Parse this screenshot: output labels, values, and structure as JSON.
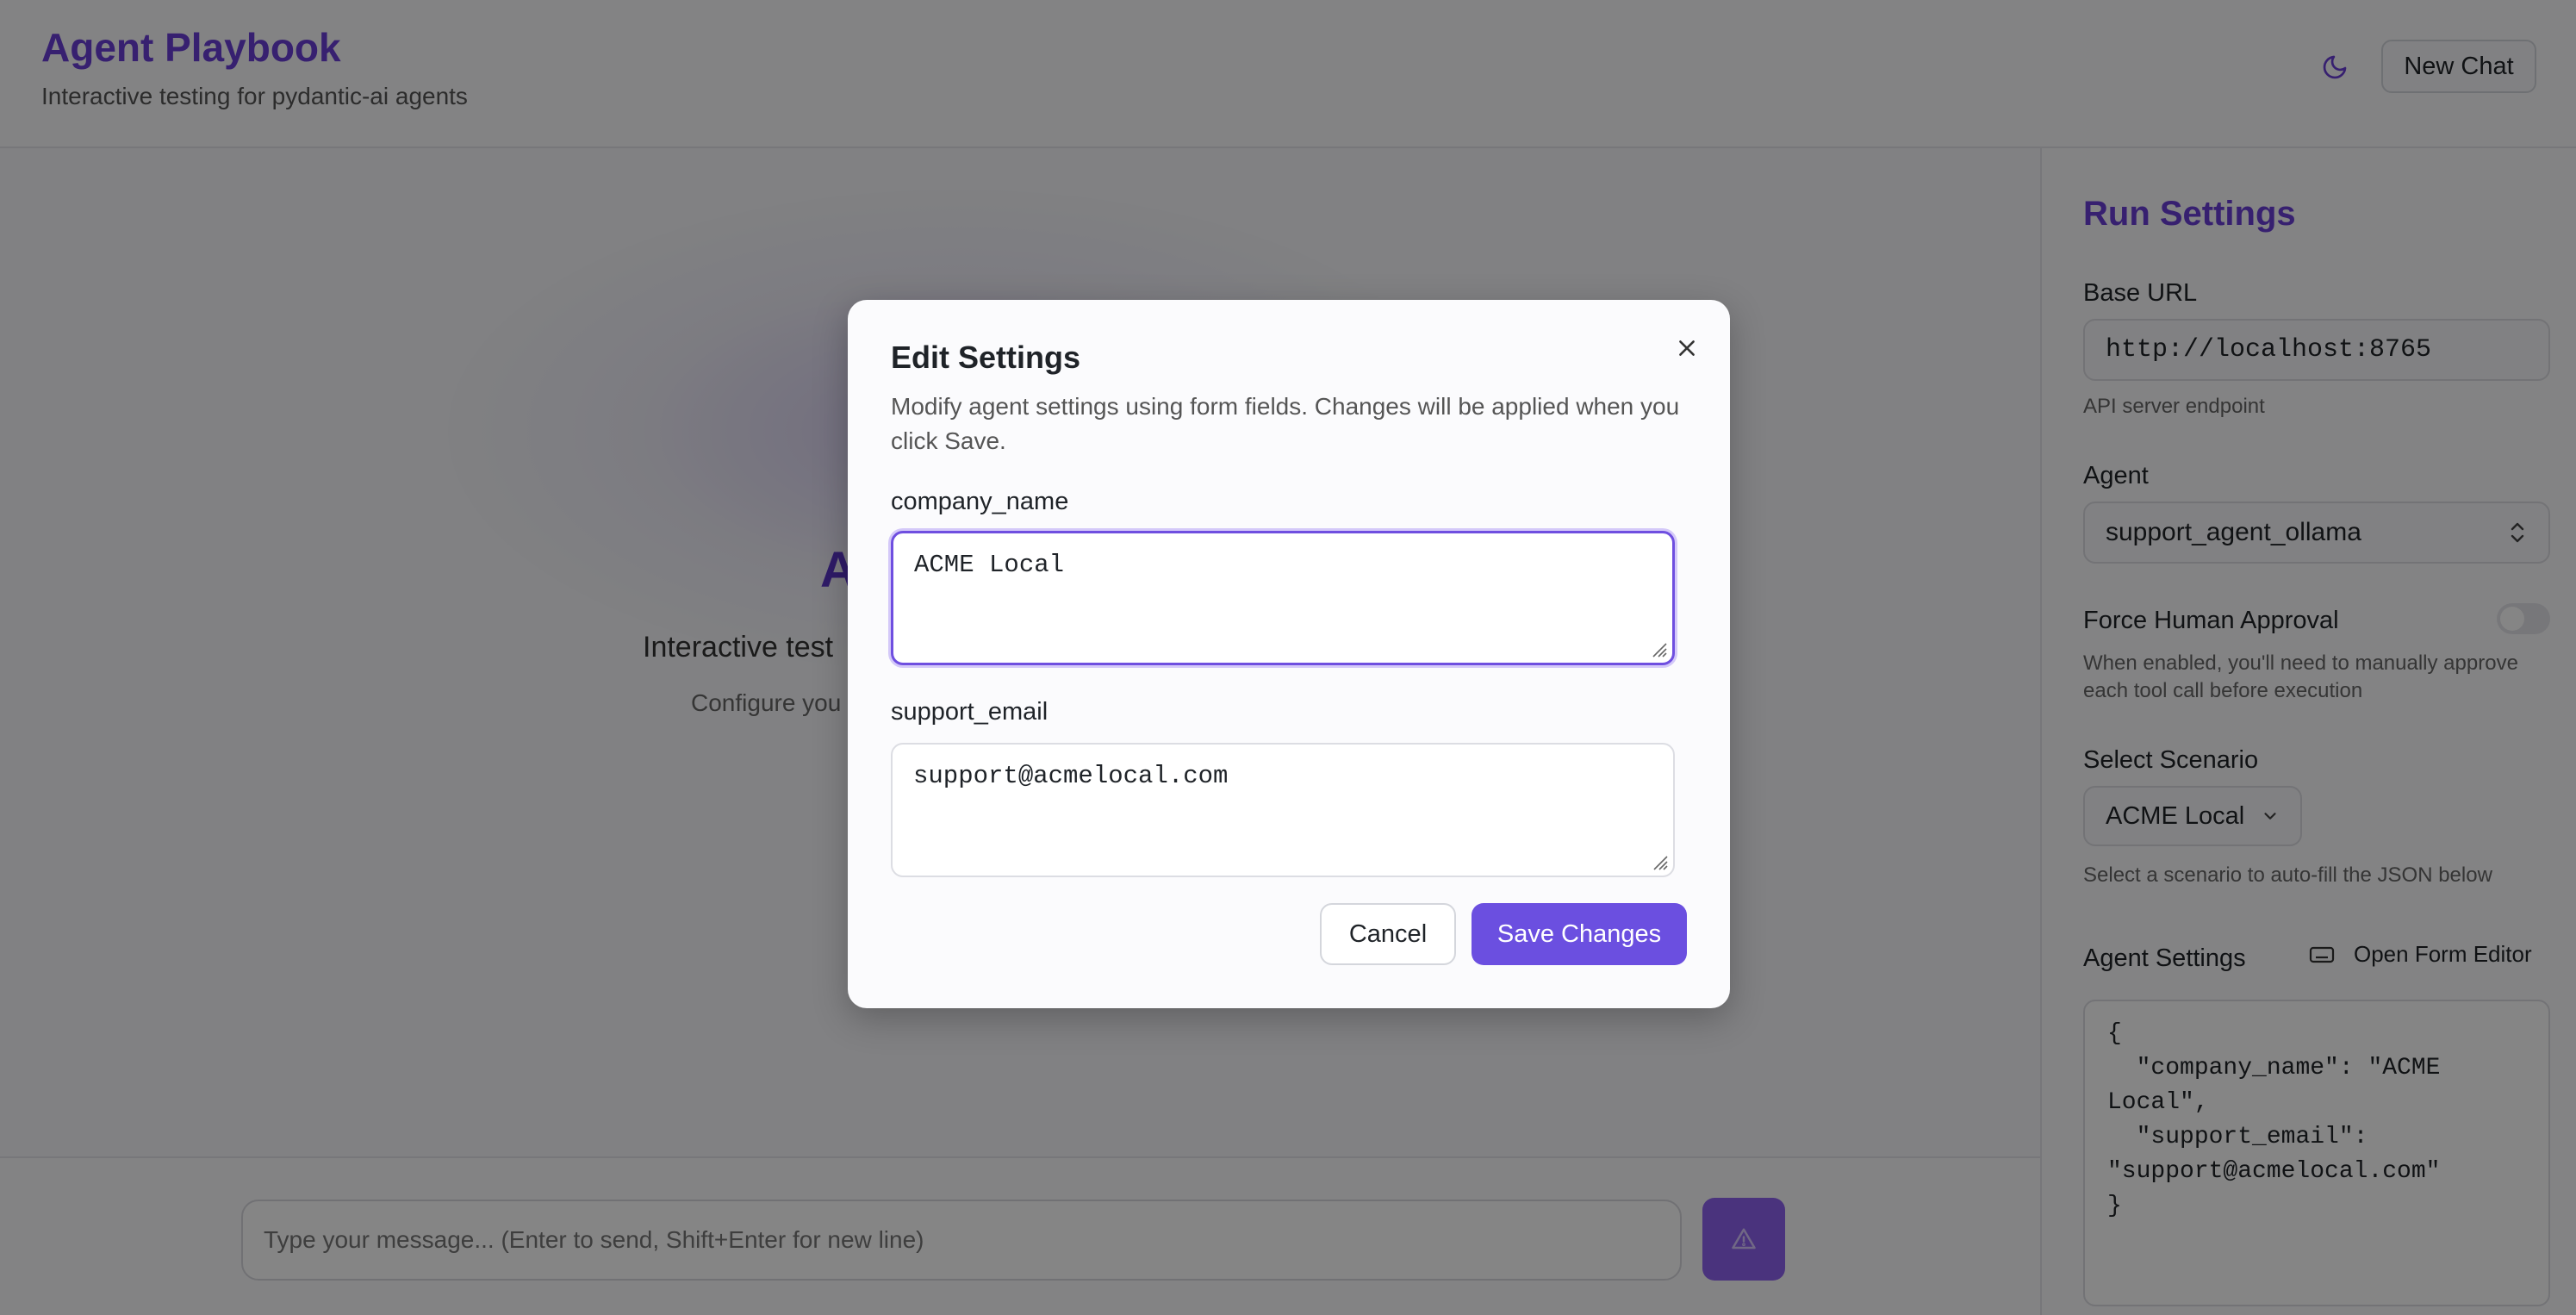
{
  "header": {
    "title": "Agent Playbook",
    "subtitle": "Interactive testing for pydantic-ai agents",
    "theme_icon": "moon-icon",
    "new_chat_label": "New Chat"
  },
  "main": {
    "hero_title_visible": "A",
    "hero_subtitle_visible": "Interactive test",
    "hero_hint_visible": "Configure you",
    "input_placeholder": "Type your message... (Enter to send, Shift+Enter for new line)",
    "send_icon": "warning-triangle-icon"
  },
  "sidebar": {
    "title": "Run Settings",
    "base_url_label": "Base URL",
    "base_url_value": "http://localhost:8765",
    "base_url_help": "API server endpoint",
    "agent_label": "Agent",
    "agent_value": "support_agent_ollama",
    "force_approval_label": "Force Human Approval",
    "force_approval_enabled": false,
    "force_approval_help": "When enabled, you'll need to manually approve each tool call before execution",
    "scenario_label": "Select Scenario",
    "scenario_value": "ACME Local",
    "scenario_help": "Select a scenario to auto-fill the JSON below",
    "agent_settings_label": "Agent Settings",
    "open_form_editor_label": "Open Form Editor",
    "agent_settings_json": "{\n  \"company_name\": \"ACME\nLocal\",\n  \"support_email\":\n\"support@acmelocal.com\"\n}"
  },
  "modal": {
    "title": "Edit Settings",
    "description": "Modify agent settings using form fields. Changes will be applied when you click Save.",
    "fields": [
      {
        "label": "company_name",
        "value": "ACME Local"
      },
      {
        "label": "support_email",
        "value": "support@acmelocal.com"
      }
    ],
    "cancel_label": "Cancel",
    "save_label": "Save Changes"
  },
  "colors": {
    "accent": "#6a3fd6",
    "primary_button": "#6b4fe0",
    "overlay": "rgba(0,0,0,0.48)"
  }
}
